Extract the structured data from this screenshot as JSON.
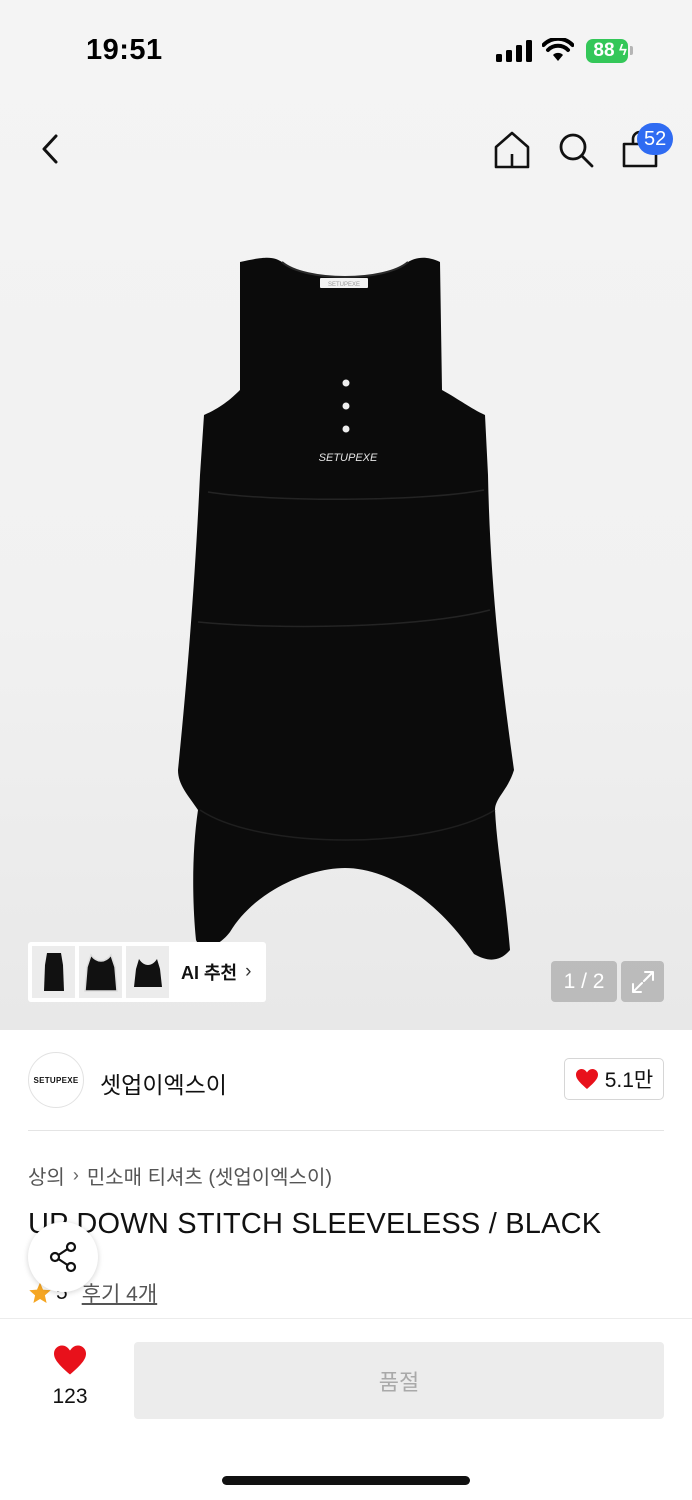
{
  "status_bar": {
    "time": "19:51",
    "battery": "88"
  },
  "nav": {
    "cart_count": "52"
  },
  "gallery": {
    "page_indicator": "1 / 2",
    "ai_label": "AI 추천"
  },
  "brand": {
    "logo_text": "SETUPEXE",
    "name": "셋업이엑스이",
    "likes": "5.1만"
  },
  "breadcrumb": {
    "level1": "상의",
    "level2": "민소매 티셔츠 (셋업이엑스이)"
  },
  "product": {
    "title": "UP DOWN STITCH SLEEVELESS / BLACK",
    "chest_print": "SETUPEXE",
    "rating": "5",
    "reviews": "후기 4개"
  },
  "bottom": {
    "wish_count": "123",
    "buy_label": "품절"
  },
  "colors": {
    "accent_blue": "#2f6bf2",
    "heart_red": "#e8111b",
    "star": "#f5a623",
    "battery_green": "#34c759"
  },
  "icons": [
    "back-icon",
    "home-icon",
    "search-icon",
    "cart-icon",
    "expand-icon",
    "heart-icon",
    "share-icon",
    "star-icon",
    "chevron-right-icon"
  ]
}
